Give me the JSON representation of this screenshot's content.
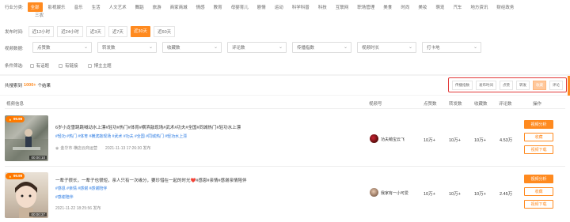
{
  "industry": {
    "label": "行业分类:",
    "row1": [
      "全部",
      "影视娱乐",
      "音乐",
      "生活",
      "人文艺术",
      "舞蹈",
      "旅游",
      "商家商城",
      "情感",
      "教育",
      "母婴育儿",
      "剧情",
      "运动",
      "科学科普",
      "科技",
      "互联网",
      "职场管理",
      "美食",
      "时尚",
      "美妆",
      "萌宠",
      "汽车",
      "地方资讯",
      "财经政务"
    ],
    "row2": [
      "三农"
    ],
    "active": "全部"
  },
  "publish_time": {
    "label": "发布时间:",
    "options": [
      "近12小时",
      "近24小时",
      "近3天",
      "近7天",
      "近30天",
      "近60天"
    ],
    "active": "近30天"
  },
  "data_filter": {
    "label": "视频数据:",
    "selects": [
      "点赞数",
      "转发数",
      "收藏数",
      "评论数",
      "传播指数",
      "视频时长",
      "打卡地"
    ]
  },
  "condition": {
    "label": "条件筛选:",
    "options": [
      "有话题",
      "有链接",
      "博主主题"
    ]
  },
  "results": {
    "prefix": "共搜索到",
    "count": "1000+",
    "suffix": "个结果"
  },
  "sort": {
    "options": [
      "传播指数",
      "发布时间",
      "点赞",
      "转发",
      "收藏",
      "评论"
    ],
    "active": "收藏"
  },
  "table": {
    "headers": [
      "视频信息",
      "视频号",
      "点赞数",
      "转发数",
      "收藏数",
      "评论数",
      "操作"
    ],
    "rows": [
      {
        "score": "99.99",
        "duration": "00:00:10",
        "title": "6岁小龙雪跳跳喊动水上漂#轻功#热门#体育#横滨敲现场#武术#功夫#全国#同城热门#轻功水上漂",
        "tags": "#轻功 #热门 #体育 #横滨敲现场 #武术 #功夫 #全国 #同城热门 #轻功水上漂",
        "location": "金华市·横店云商运营",
        "date": "2021-11-13 17:26:30 发布",
        "account": "功夫萌宝云飞",
        "likes": "10万+",
        "shares": "10万+",
        "favorites": "10万+",
        "comments": "4.53万",
        "btn_analyze": "视频分析",
        "btn_fav": "收藏",
        "btn_download": "视频下载"
      },
      {
        "score": "99.99",
        "duration": "00:00:37",
        "title": "一辈子很长，一辈子也很短，亲人只有一次缘分，要珍惜在一起的时光❤️#感恩#亲情#感谢亲情陪伴",
        "tags": "#感恩 #亲情 #感谢 #感谢陪伴",
        "location": "",
        "date": "2021-11-22 18:25:56 发布",
        "account": "我家有一小可爱",
        "likes": "10万+",
        "shares": "10万+",
        "favorites": "10万+",
        "comments": "2.45万",
        "btn_analyze": "视频分析",
        "btn_fav": "收藏",
        "btn_download": "视频下载"
      }
    ]
  },
  "colors": {
    "accent": "#ff8a1f",
    "highlight_border": "#e23a3a",
    "link": "#2a7ae2"
  }
}
